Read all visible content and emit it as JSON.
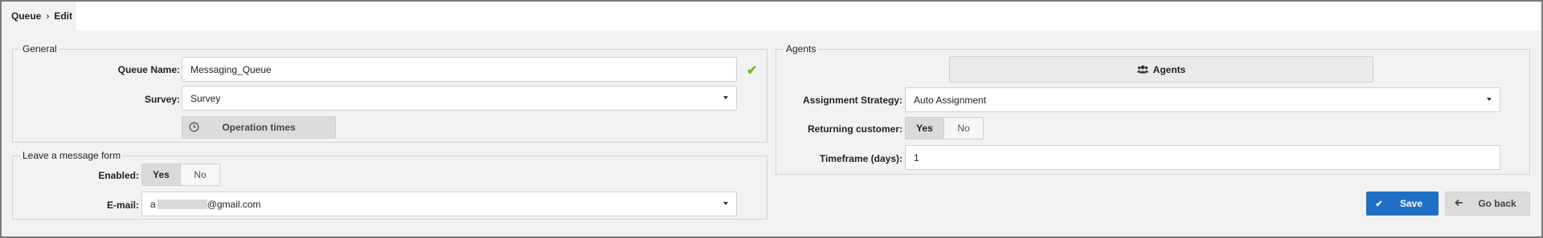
{
  "breadcrumb": {
    "root": "Queue",
    "separator": "›",
    "current": "Edit"
  },
  "general": {
    "legend": "General",
    "queue_name_label": "Queue Name:",
    "queue_name_value": "Messaging_Queue",
    "survey_label": "Survey:",
    "survey_value": "Survey",
    "operation_times_label": "Operation times"
  },
  "leave_message": {
    "legend": "Leave a message form",
    "enabled_label": "Enabled:",
    "yes": "Yes",
    "no": "No",
    "email_label": "E-mail:",
    "email_prefix": "a",
    "email_suffix": "@gmail.com"
  },
  "agents": {
    "legend": "Agents",
    "agents_button_label": "Agents",
    "assignment_label": "Assignment Strategy:",
    "assignment_value": "Auto Assignment",
    "returning_label": "Returning customer:",
    "yes": "Yes",
    "no": "No",
    "timeframe_label": "Timeframe (days):",
    "timeframe_value": "1"
  },
  "actions": {
    "save_label": "Save",
    "back_label": "Go back"
  },
  "colors": {
    "accent": "#1f6fc4",
    "check": "#6cbf2b",
    "background": "#f2f2f2"
  },
  "icons": [
    "check-icon",
    "clock-icon",
    "users-icon",
    "chevron-down-icon",
    "arrow-left-icon"
  ]
}
